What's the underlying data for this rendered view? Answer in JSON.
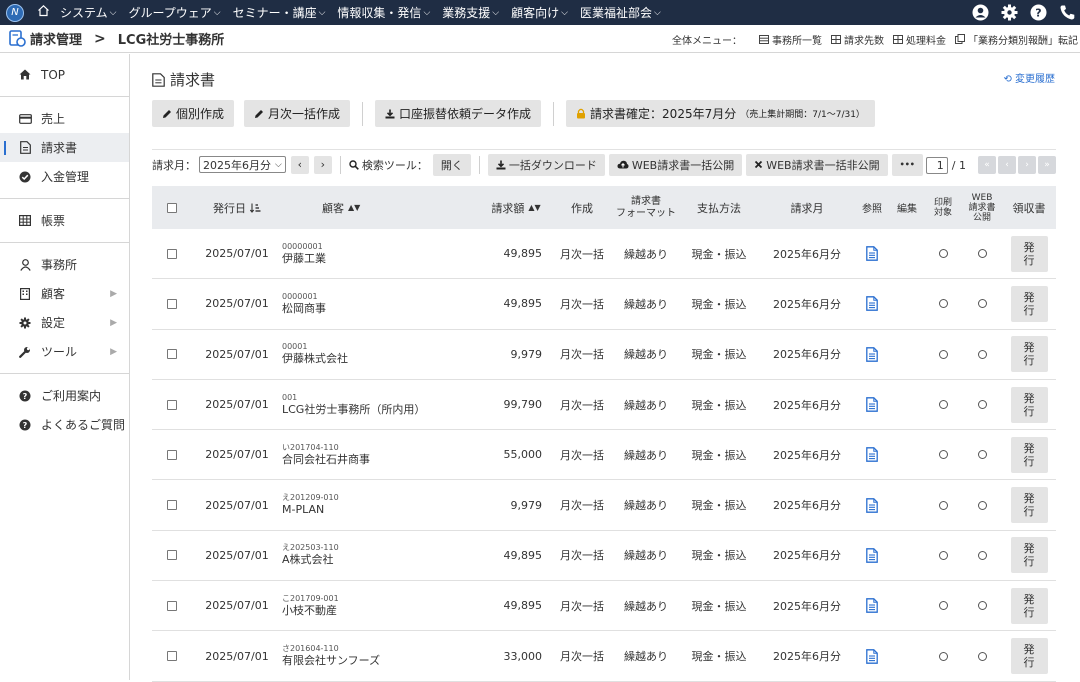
{
  "topnav": {
    "logo_text": "N",
    "menu": [
      "システム",
      "グループウェア",
      "セミナー・講座",
      "情報収集・発信",
      "業務支援",
      "顧客向け",
      "医業福祉部会"
    ],
    "icons": [
      "user-icon",
      "gear-icon",
      "help-icon",
      "phone-icon"
    ]
  },
  "breadcrumb": {
    "app": "請求管理",
    "separator": ">",
    "office": "LCG社労士事務所",
    "all_menu_label": "全体メニュー：",
    "links": [
      "事務所一覧",
      "請求先数",
      "処理料金",
      "「業務分類別報酬」転記"
    ]
  },
  "sidebar": {
    "groups": [
      [
        {
          "label": "TOP",
          "icon": "home-icon"
        }
      ],
      [
        {
          "label": "売上",
          "icon": "card-icon"
        },
        {
          "label": "請求書",
          "icon": "document-icon",
          "active": true
        },
        {
          "label": "入金管理",
          "icon": "check-circle-icon"
        }
      ],
      [
        {
          "label": "帳票",
          "icon": "table-icon"
        }
      ],
      [
        {
          "label": "事務所",
          "icon": "person-icon"
        },
        {
          "label": "顧客",
          "icon": "building-icon",
          "submenu": true
        },
        {
          "label": "設定",
          "icon": "gear-icon",
          "submenu": true
        },
        {
          "label": "ツール",
          "icon": "wrench-icon",
          "submenu": true
        }
      ],
      [
        {
          "label": "ご利用案内",
          "icon": "question-icon"
        },
        {
          "label": "よくあるご質問",
          "icon": "question-icon"
        }
      ]
    ]
  },
  "page": {
    "title": "請求書",
    "history_link": "変更履歴",
    "actions": {
      "individual": "個別作成",
      "monthly": "月次一括作成",
      "transfer": "口座振替依頼データ作成",
      "confirm": "請求書確定：2025年7月分",
      "confirm_period": "（売上集計期間：7/1〜7/31）"
    },
    "toolbar": {
      "month_label": "請求月：",
      "month_value": "2025年6月分",
      "search_label": "検索ツール：",
      "open": "開く",
      "download": "一括ダウンロード",
      "web_publish": "WEB請求書一括公開",
      "web_unpublish": "WEB請求書一括非公開",
      "more": "•••",
      "page_current": "1",
      "page_total": "/ 1"
    },
    "table": {
      "headers": {
        "date": "発行日",
        "customer": "顧客",
        "amount": "請求額",
        "created": "作成",
        "format": "請求書\nフォーマット",
        "payment": "支払方法",
        "month": "請求月",
        "ref": "参照",
        "edit": "編集",
        "print": "印刷\n対象",
        "web": "WEB\n請求書\n公開",
        "receipt": "領収書"
      },
      "issue_label": "発行",
      "rows": [
        {
          "date": "2025/07/01",
          "code": "00000001",
          "name": "伊藤工業",
          "amount": "49,895",
          "created": "月次一括",
          "format": "繰越あり",
          "payment": "現金・振込",
          "month": "2025年6月分"
        },
        {
          "date": "2025/07/01",
          "code": "0000001",
          "name": "松岡商事",
          "amount": "49,895",
          "created": "月次一括",
          "format": "繰越あり",
          "payment": "現金・振込",
          "month": "2025年6月分"
        },
        {
          "date": "2025/07/01",
          "code": "00001",
          "name": "伊藤株式会社",
          "amount": "9,979",
          "created": "月次一括",
          "format": "繰越あり",
          "payment": "現金・振込",
          "month": "2025年6月分"
        },
        {
          "date": "2025/07/01",
          "code": "001",
          "name": "LCG社労士事務所（所内用）",
          "amount": "99,790",
          "created": "月次一括",
          "format": "繰越あり",
          "payment": "現金・振込",
          "month": "2025年6月分"
        },
        {
          "date": "2025/07/01",
          "code": "い201704-110",
          "name": "合同会社石井商事",
          "amount": "55,000",
          "created": "月次一括",
          "format": "繰越あり",
          "payment": "現金・振込",
          "month": "2025年6月分"
        },
        {
          "date": "2025/07/01",
          "code": "え201209-010",
          "name": "M-PLAN",
          "amount": "9,979",
          "created": "月次一括",
          "format": "繰越あり",
          "payment": "現金・振込",
          "month": "2025年6月分"
        },
        {
          "date": "2025/07/01",
          "code": "え202503-110",
          "name": "A株式会社",
          "amount": "49,895",
          "created": "月次一括",
          "format": "繰越あり",
          "payment": "現金・振込",
          "month": "2025年6月分"
        },
        {
          "date": "2025/07/01",
          "code": "こ201709-001",
          "name": "小枝不動産",
          "amount": "49,895",
          "created": "月次一括",
          "format": "繰越あり",
          "payment": "現金・振込",
          "month": "2025年6月分"
        },
        {
          "date": "2025/07/01",
          "code": "さ201604-110",
          "name": "有限会社サンフーズ",
          "amount": "33,000",
          "created": "月次一括",
          "format": "繰越あり",
          "payment": "現金・振込",
          "month": "2025年6月分"
        }
      ]
    }
  },
  "colors": {
    "nav_bg": "#1f2d44",
    "accent": "#2a6fd0",
    "ref_icon": "#2a6fd0",
    "lock": "#e0a100"
  }
}
